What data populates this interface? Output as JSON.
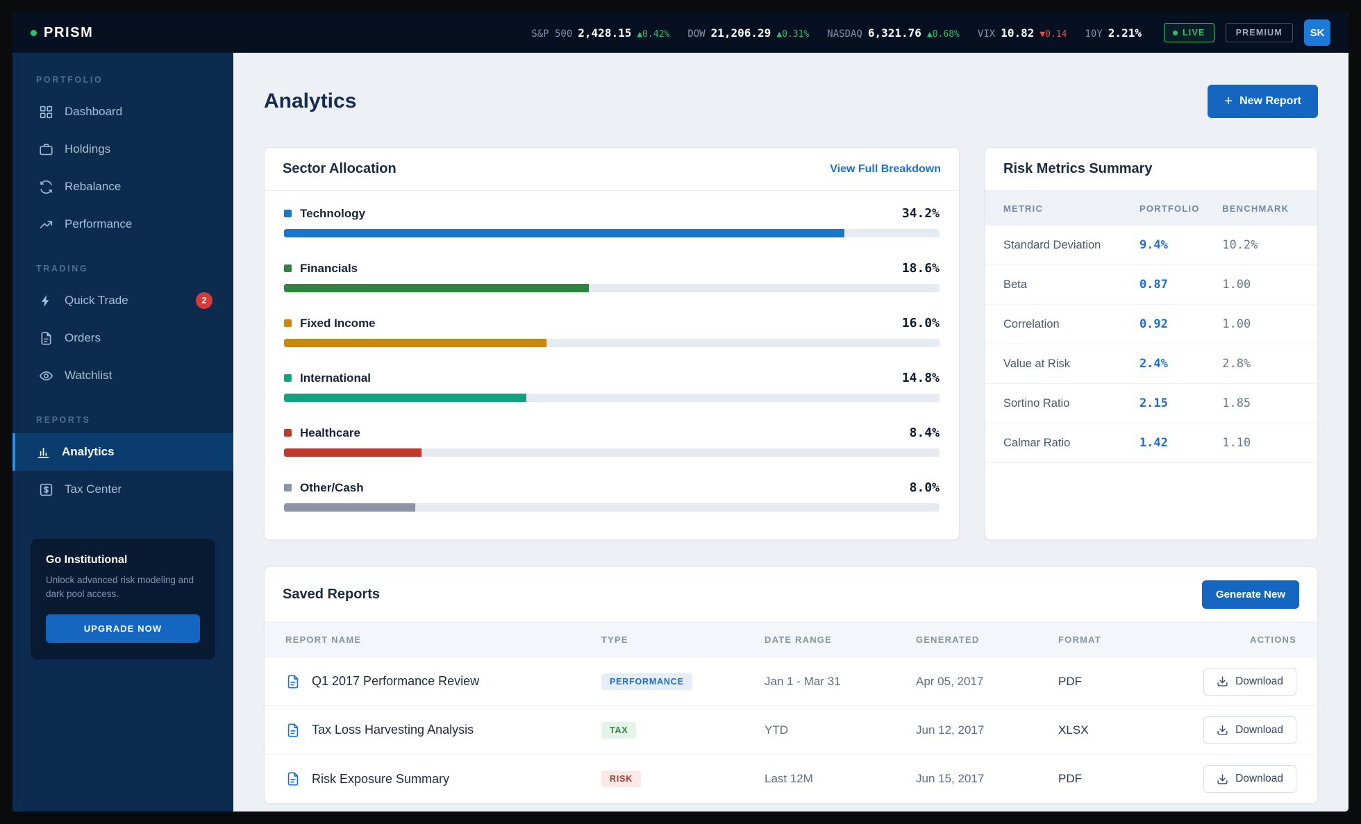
{
  "colors": {
    "accent": "#1566c0",
    "positive": "#2fbf71",
    "negative": "#e5534b",
    "sidebar_bg": "#0d2b4e",
    "active_border": "#2f8ee8"
  },
  "topbar": {
    "logo": "PRISM",
    "tickers": [
      {
        "label": "S&P 500",
        "value": "2,428.15",
        "change": "▲0.42%",
        "dir": "up"
      },
      {
        "label": "DOW",
        "value": "21,206.29",
        "change": "▲0.31%",
        "dir": "up"
      },
      {
        "label": "NASDAQ",
        "value": "6,321.76",
        "change": "▲0.68%",
        "dir": "up"
      },
      {
        "label": "VIX",
        "value": "10.82",
        "change": "▼0.14",
        "dir": "down"
      },
      {
        "label": "10Y",
        "value": "2.21%",
        "change": "",
        "dir": ""
      }
    ],
    "live_badge": "LIVE",
    "premium_badge": "PREMIUM",
    "avatar_initials": "SK"
  },
  "sidebar": {
    "sections": [
      {
        "label": "PORTFOLIO",
        "items": [
          {
            "label": "Dashboard",
            "icon": "dashboard-grid-icon"
          },
          {
            "label": "Holdings",
            "icon": "briefcase-icon"
          },
          {
            "label": "Rebalance",
            "icon": "refresh-icon"
          },
          {
            "label": "Performance",
            "icon": "trend-up-icon"
          }
        ]
      },
      {
        "label": "TRADING",
        "items": [
          {
            "label": "Quick Trade",
            "icon": "bolt-icon",
            "badge": "2"
          },
          {
            "label": "Orders",
            "icon": "document-icon"
          },
          {
            "label": "Watchlist",
            "icon": "eye-icon"
          }
        ]
      },
      {
        "label": "REPORTS",
        "items": [
          {
            "label": "Analytics",
            "icon": "bar-chart-icon",
            "active": true
          },
          {
            "label": "Tax Center",
            "icon": "dollar-icon"
          }
        ]
      }
    ],
    "promo": {
      "title": "Go Institutional",
      "body": "Unlock advanced risk modeling and dark pool access.",
      "cta": "UPGRADE NOW"
    }
  },
  "main": {
    "title": "Analytics",
    "new_report": {
      "label": "New Report",
      "icon": "plus-icon",
      "icon_glyph": "+"
    },
    "sector_allocation": {
      "title": "Sector Allocation",
      "link_label": "View Full Breakdown",
      "chart_data": {
        "type": "bar",
        "orientation": "horizontal",
        "title": "Sector Allocation",
        "categories": [
          "Technology",
          "Financials",
          "Fixed Income",
          "International",
          "Healthcare",
          "Other/Cash"
        ],
        "values": [
          34.2,
          18.6,
          16.0,
          14.8,
          8.4,
          8.0
        ],
        "value_labels": [
          "34.2%",
          "18.6%",
          "16.0%",
          "14.8%",
          "8.4%",
          "8.0%"
        ],
        "colors": [
          "#1878c8",
          "#2e8540",
          "#c8870e",
          "#10a37f",
          "#c0392b",
          "#8b95a5"
        ],
        "scale_max": 40,
        "unit": "%"
      }
    },
    "risk_metrics": {
      "title": "Risk Metrics Summary",
      "columns": [
        "METRIC",
        "PORTFOLIO",
        "BENCHMARK"
      ],
      "rows": [
        {
          "metric": "Standard Deviation",
          "portfolio": "9.4%",
          "benchmark": "10.2%"
        },
        {
          "metric": "Beta",
          "portfolio": "0.87",
          "benchmark": "1.00"
        },
        {
          "metric": "Correlation",
          "portfolio": "0.92",
          "benchmark": "1.00"
        },
        {
          "metric": "Value at Risk",
          "portfolio": "2.4%",
          "benchmark": "2.8%"
        },
        {
          "metric": "Sortino Ratio",
          "portfolio": "2.15",
          "benchmark": "1.85"
        },
        {
          "metric": "Calmar Ratio",
          "portfolio": "1.42",
          "benchmark": "1.10"
        }
      ]
    },
    "saved_reports": {
      "title": "Saved Reports",
      "generate_label": "Generate New",
      "columns": [
        "REPORT NAME",
        "TYPE",
        "DATE RANGE",
        "GENERATED",
        "FORMAT",
        "ACTIONS"
      ],
      "rows": [
        {
          "icon": "file-icon",
          "name": "Q1 2017 Performance Review",
          "type": "PERFORMANCE",
          "type_variant": "performance",
          "date_range": "Jan 1 - Mar 31",
          "generated": "Apr 05, 2017",
          "format": "PDF",
          "action": {
            "label": "Download",
            "icon": "download-icon"
          }
        },
        {
          "icon": "file-icon",
          "name": "Tax Loss Harvesting Analysis",
          "type": "TAX",
          "type_variant": "tax",
          "date_range": "YTD",
          "generated": "Jun 12, 2017",
          "format": "XLSX",
          "action": {
            "label": "Download",
            "icon": "download-icon"
          }
        },
        {
          "icon": "file-icon",
          "name": "Risk Exposure Summary",
          "type": "RISK",
          "type_variant": "risk",
          "date_range": "Last 12M",
          "generated": "Jun 15, 2017",
          "format": "PDF",
          "action": {
            "label": "Download",
            "icon": "download-icon"
          }
        }
      ]
    }
  }
}
